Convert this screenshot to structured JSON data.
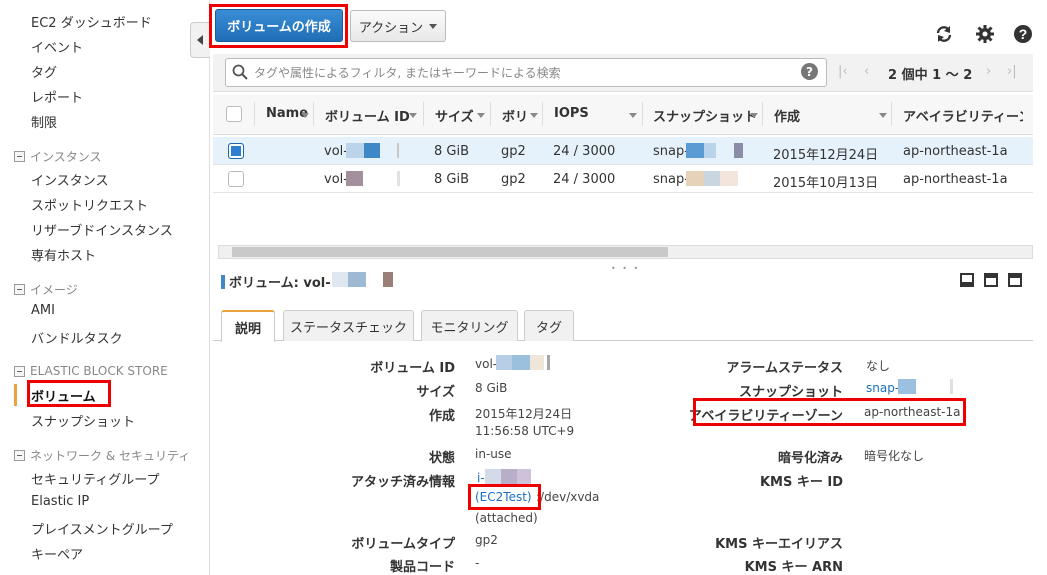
{
  "sidebar": {
    "dashboard": "EC2 ダッシュボード",
    "events": "イベント",
    "tags": "タグ",
    "reports": "レポート",
    "limits": "制限",
    "groups": {
      "instances": {
        "title": "インスタンス",
        "items": [
          "インスタンス",
          "スポットリクエスト",
          "リザーブドインスタンス",
          "専有ホスト"
        ]
      },
      "images": {
        "title": "イメージ",
        "items": [
          "AMI",
          "バンドルタスク"
        ]
      },
      "ebs": {
        "title": "ELASTIC BLOCK STORE",
        "items": [
          "ボリューム",
          "スナップショット"
        ]
      },
      "network": {
        "title": "ネットワーク & セキュリティ",
        "items": [
          "セキュリティグループ",
          "Elastic IP",
          "プレイスメントグループ",
          "キーペア"
        ]
      }
    }
  },
  "toolbar": {
    "create_volume": "ボリュームの作成",
    "actions": "アクション",
    "icons": [
      "refresh-icon",
      "gear-icon",
      "help-icon"
    ]
  },
  "filter": {
    "placeholder": "タグや属性によるフィルタ, またはキーワードによる検索",
    "pagination": "2 個中 1 〜 2"
  },
  "table": {
    "headers": [
      "Name",
      "ボリューム ID",
      "サイズ",
      "ボリ",
      "IOPS",
      "スナップショット",
      "作成",
      "アベイラビリティーン"
    ],
    "rows": [
      {
        "id": "vol-",
        "size": "8 GiB",
        "type": "gp2",
        "iops": "24 / 3000",
        "snapshot": "snap-",
        "created": "2015年12月24日",
        "az": "ap-northeast-1a",
        "selected": true
      },
      {
        "id": "vol-",
        "size": "8 GiB",
        "type": "gp2",
        "iops": "24 / 3000",
        "snapshot": "snap-",
        "created": "2015年10月13日",
        "az": "ap-northeast-1a",
        "selected": false
      }
    ]
  },
  "detail": {
    "title_label": "ボリューム:",
    "title_value": "vol-",
    "tabs": [
      "説明",
      "ステータスチェック",
      "モニタリング",
      "タグ"
    ],
    "left": {
      "volume_id_label": "ボリューム ID",
      "volume_id_value": "vol-",
      "size_label": "サイズ",
      "size_value": "8 GiB",
      "created_label": "作成",
      "created_date": "2015年12月24日",
      "created_time": "11:56:58 UTC+9",
      "state_label": "状態",
      "state_value": "in-use",
      "attach_label": "アタッチ済み情報",
      "attach_instance": "i-",
      "attach_name": "(EC2Test)",
      "attach_device": ":/dev/xvda",
      "attach_status": "(attached)",
      "volume_type_label": "ボリュームタイプ",
      "volume_type_value": "gp2",
      "product_code_label": "製品コード",
      "product_code_value": "-"
    },
    "right": {
      "alarm_label": "アラームステータス",
      "alarm_value": "なし",
      "snapshot_label": "スナップショット",
      "snapshot_value": "snap-",
      "az_label": "アベイラビリティーゾーン",
      "az_value": "ap-northeast-1a",
      "encryption_label": "暗号化済み",
      "encryption_value": "暗号化なし",
      "kms_id_label": "KMS キー ID",
      "kms_alias_label": "KMS キーエイリアス",
      "kms_arn_label": "KMS キー ARN"
    }
  },
  "colors": {
    "primary": "#1f6db5",
    "highlight": "#e00000",
    "active_nav": "#e8a33d",
    "selected_row": "#e5f1fb",
    "link": "#1a6fc0"
  }
}
